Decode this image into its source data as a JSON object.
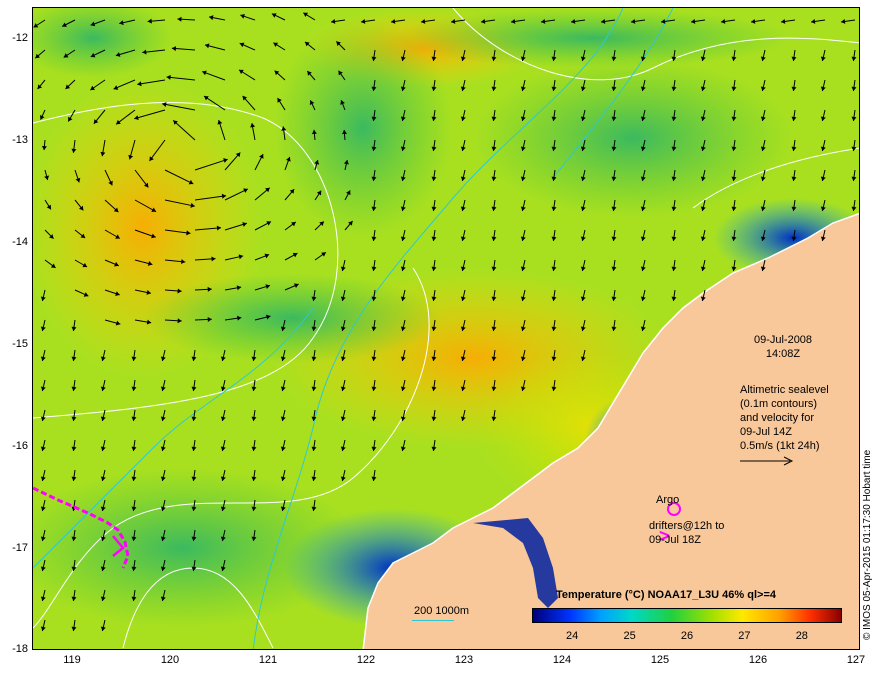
{
  "map": {
    "y_ticks": [
      "-12",
      "-13",
      "-14",
      "-15",
      "-16",
      "-17",
      "-18"
    ],
    "x_ticks": [
      "119",
      "120",
      "121",
      "122",
      "123",
      "124",
      "125",
      "126",
      "127"
    ],
    "lat_range": [
      -18,
      -11.9
    ],
    "lon_range": [
      118.6,
      127
    ],
    "date": "09-Jul-2008",
    "time": "14:08Z",
    "altimetry_note": [
      "Altimetric sealevel",
      "(0.1m contours)",
      "and velocity for",
      "09-Jul 14Z",
      "0.5m/s (1kt 24h)"
    ],
    "argo_label": "Argo",
    "drifters_label": [
      "drifters@12h to",
      "09-Jul 18Z"
    ],
    "scale_label": "200  1000m",
    "credit": "© IMOS 05-Apr-2015 01:17:30 Hobart time",
    "colors": {
      "land": "#f8c89a",
      "drifter": "#ff00ff",
      "contour": "#ffffff",
      "isobath": "#30c8d0",
      "arrow": "#000000"
    }
  },
  "colorbar": {
    "title": "Temperature (°C) NOAA17_L3U 46% ql>=4",
    "ticks": [
      "24",
      "25",
      "26",
      "27",
      "28"
    ],
    "range": [
      23.3,
      28.7
    ]
  }
}
